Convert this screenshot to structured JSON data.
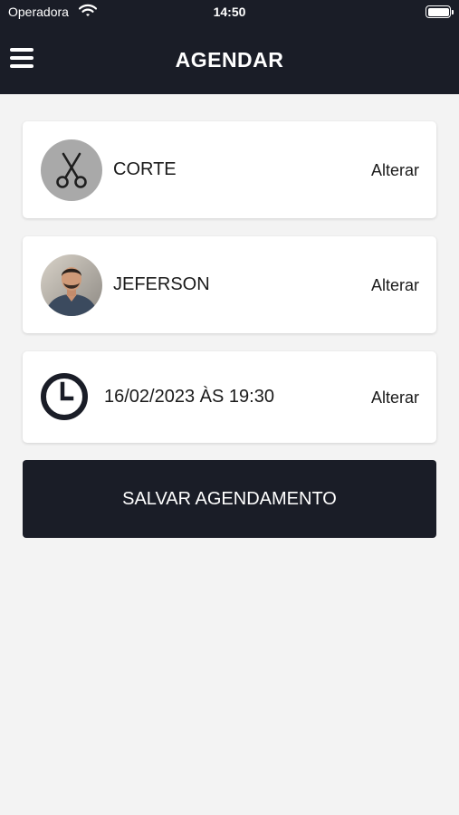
{
  "status_bar": {
    "carrier": "Operadora",
    "time": "14:50"
  },
  "header": {
    "title": "AGENDAR"
  },
  "service_card": {
    "label": "CORTE",
    "action": "Alterar"
  },
  "barber_card": {
    "label": "JEFERSON",
    "action": "Alterar"
  },
  "datetime_card": {
    "label": "16/02/2023 ÀS 19:30",
    "action": "Alterar"
  },
  "save_button": {
    "label": "SALVAR AGENDAMENTO"
  },
  "colors": {
    "dark": "#1a1d27",
    "background": "#f3f3f3",
    "card": "#ffffff",
    "service_icon_bg": "#a9a9a9"
  },
  "icons": {
    "menu": "hamburger-icon",
    "service": "scissors-icon",
    "datetime": "clock-icon"
  }
}
